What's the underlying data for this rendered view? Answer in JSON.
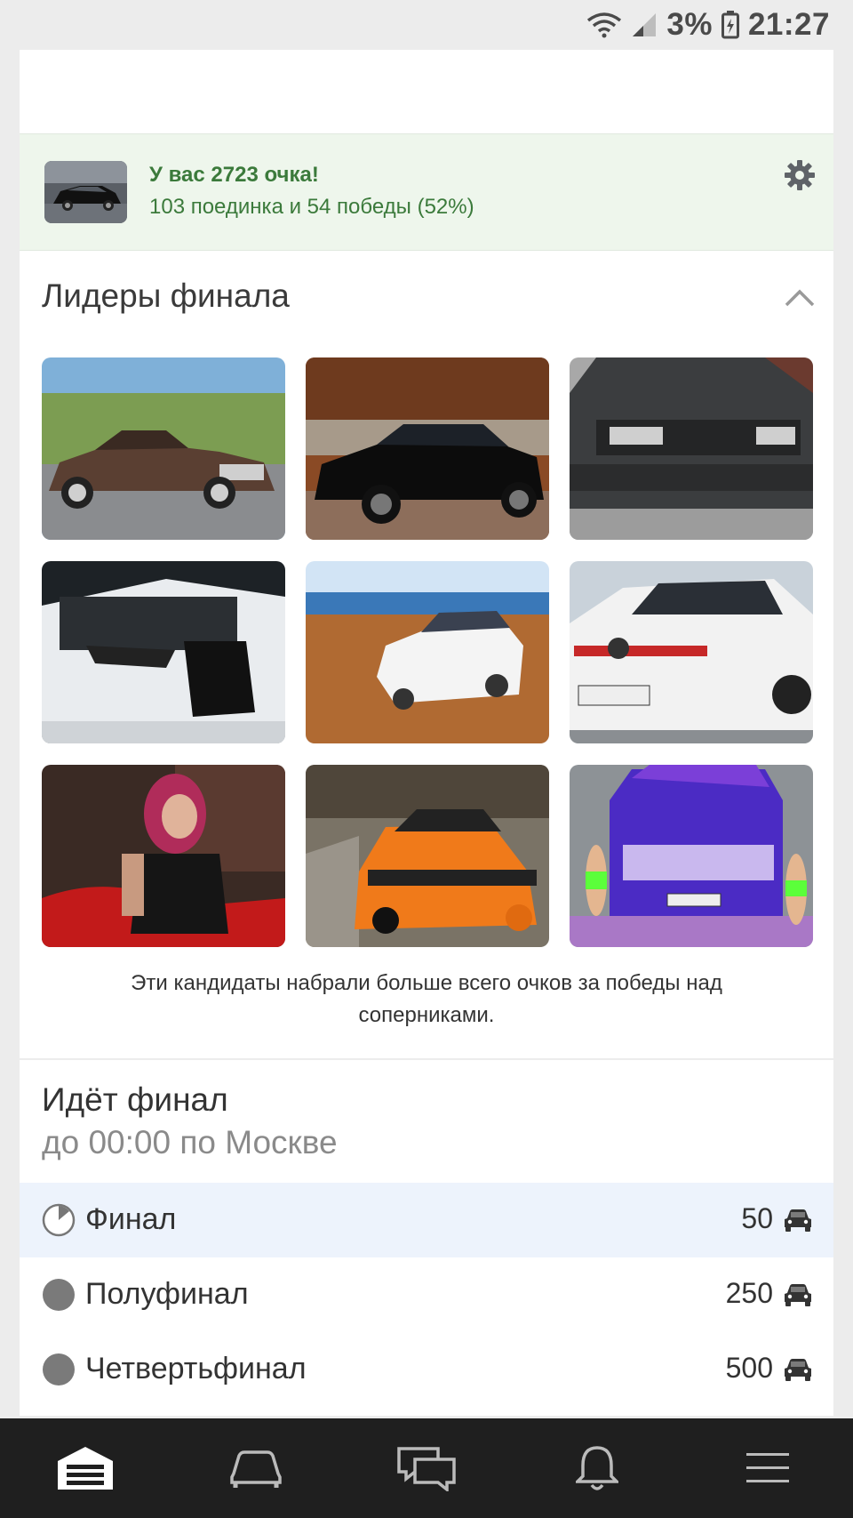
{
  "status_bar": {
    "battery": "3%",
    "time": "21:27"
  },
  "points_banner": {
    "title": "У вас 2723 очка!",
    "subtitle": "103 поединка и 54 победы (52%)"
  },
  "leaders": {
    "title": "Лидеры финала",
    "caption": "Эти кандидаты набрали больше всего очков за победы над соперниками."
  },
  "final": {
    "title": "Идёт финал",
    "subtitle": "до 00:00 по Москве",
    "stages": [
      {
        "label": "Финал",
        "count": "50"
      },
      {
        "label": "Полуфинал",
        "count": "250"
      },
      {
        "label": "Четвертьфинал",
        "count": "500"
      }
    ]
  },
  "colors": {
    "accent_green": "#3b7a3b",
    "banner_bg": "#eef6ec",
    "active_row_bg": "#edf3fc",
    "nav_bg": "#1f1f1f"
  },
  "icons": {
    "nav": [
      "garage-icon",
      "car-icon",
      "chat-icon",
      "bell-icon",
      "menu-icon"
    ]
  }
}
